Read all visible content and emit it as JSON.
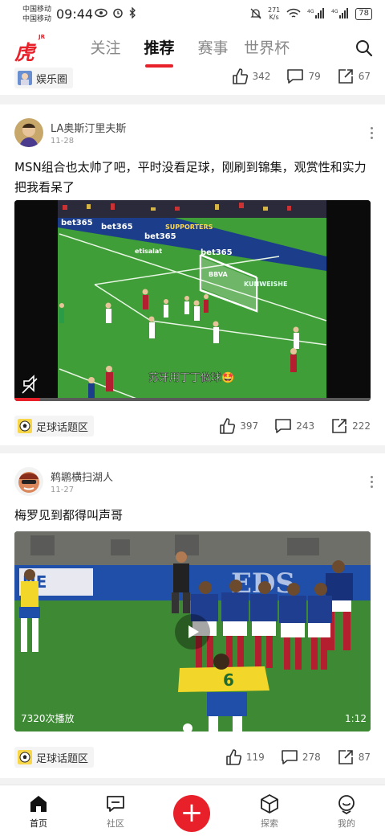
{
  "status": {
    "carrier1": "中国移动",
    "carrier2": "中国移动",
    "time": "09:44",
    "speed_value": "271",
    "speed_unit": "K/s",
    "signal1_label": "4G",
    "signal2_label": "4G",
    "battery": "78"
  },
  "header": {
    "logo": "虎扑",
    "logo_sub": "JR",
    "tabs": [
      {
        "label": "关注",
        "active": false
      },
      {
        "label": "推荐",
        "active": true
      },
      {
        "label": "赛事",
        "active": false
      },
      {
        "label": "世界杯",
        "active": false
      }
    ]
  },
  "prev_post": {
    "tag": "娱乐圈",
    "likes": "342",
    "comments": "79",
    "shares": "67"
  },
  "posts": [
    {
      "author": "LA奥斯汀里夫斯",
      "date": "11-28",
      "text": "MSN组合也太帅了吧，平时没看足球，刚刷到锦集，观赏性和实力把我看呆了",
      "video_caption": "苏牙用丁丁做球🤩",
      "video_progress": 0.07,
      "board_texts": [
        "bet365",
        "bet365",
        "bet365",
        "bet365",
        "SUPPORTERS",
        "etisalat",
        "BBVA",
        "KUNWEISHE"
      ],
      "tag": "足球话题区",
      "likes": "397",
      "comments": "243",
      "shares": "222"
    },
    {
      "author": "鹈鹕横扫湖人",
      "date": "11-27",
      "text": "梅罗见到都得叫声哥",
      "play_count": "7320次播放",
      "duration": "1:12",
      "board_texts": [
        "EDS",
        "NE"
      ],
      "jersey_number": "6",
      "tag": "足球话题区",
      "likes": "119",
      "comments": "278",
      "shares": "87"
    }
  ],
  "bottom_nav": [
    {
      "label": "首页",
      "icon": "home-icon",
      "active": true
    },
    {
      "label": "社区",
      "icon": "community-icon",
      "active": false
    },
    {
      "label": "+",
      "icon": "plus-icon",
      "active": false
    },
    {
      "label": "探索",
      "icon": "explore-icon",
      "active": false
    },
    {
      "label": "我的",
      "icon": "profile-icon",
      "active": false
    }
  ],
  "colors": {
    "accent": "#e8202a",
    "pitch": "#3f9e37",
    "text": "#222222"
  }
}
